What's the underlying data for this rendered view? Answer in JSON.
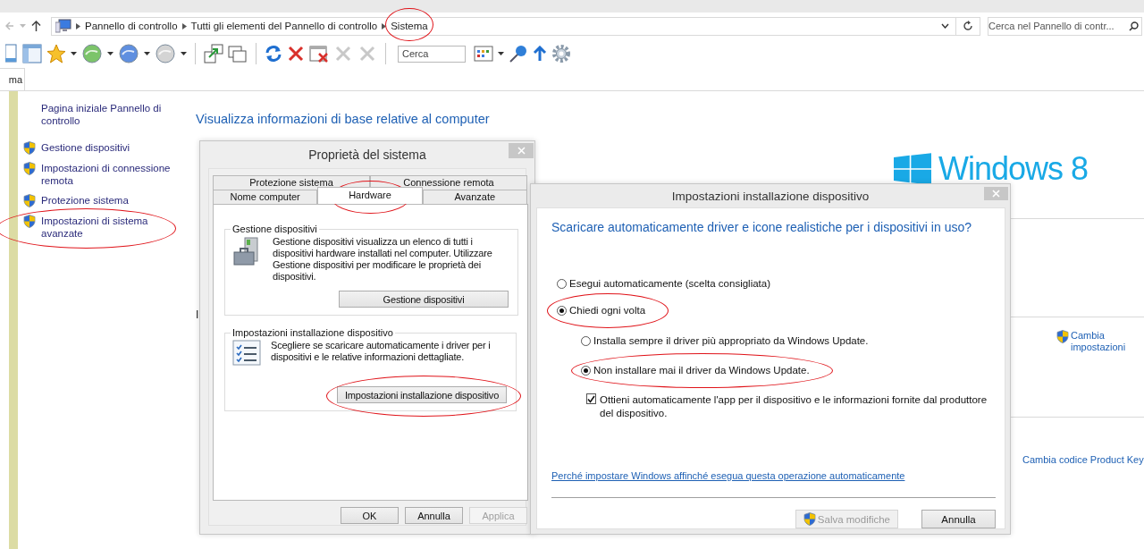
{
  "address_bar": {
    "breadcrumbs": [
      {
        "label": "Pannello di controllo",
        "circled": false
      },
      {
        "label": "Tutti gli elementi del Pannello di controllo",
        "circled": false
      },
      {
        "label": "Sistema",
        "circled": true
      }
    ],
    "search_placeholder": "Cerca nel Pannello di contr..."
  },
  "toolbar": {
    "search_placeholder": "Cerca",
    "tab_fragment": "ma"
  },
  "sidebar": {
    "home_link": "Pagina iniziale Pannello di controllo",
    "items": [
      {
        "label": "Gestione dispositivi",
        "circled": false
      },
      {
        "label": "Impostazioni di connessione remota",
        "circled": false
      },
      {
        "label": "Protezione sistema",
        "circled": false
      },
      {
        "label": "Impostazioni di sistema avanzate",
        "circled": true
      }
    ]
  },
  "main": {
    "heading": "Visualizza informazioni di base relative al computer",
    "fragments": [
      "I"
    ],
    "logo_text": "Windows 8",
    "links": [
      {
        "label": "Cambia impostazioni",
        "shield": true
      },
      {
        "label": "Cambia codice Product Key",
        "shield": false
      }
    ]
  },
  "system_properties": {
    "title": "Proprietà del sistema",
    "tab_rows": [
      {
        "tabs": [
          {
            "label": "Protezione sistema",
            "selected": false,
            "circled": false
          },
          {
            "label": "Connessione remota",
            "selected": false,
            "circled": false
          }
        ]
      },
      {
        "tabs": [
          {
            "label": "Nome computer",
            "selected": false,
            "circled": false
          },
          {
            "label": "Hardware",
            "selected": true,
            "circled": true
          },
          {
            "label": "Avanzate",
            "selected": false,
            "circled": false
          }
        ]
      }
    ],
    "groups": [
      {
        "kind": "device-manager",
        "title": "Gestione dispositivi",
        "text": "Gestione dispositivi visualizza un elenco di tutti i dispositivi hardware installati nel computer. Utilizzare Gestione dispositivi per modificare le proprietà dei dispositivi.",
        "button": {
          "label": "Gestione dispositivi",
          "circled": false
        }
      },
      {
        "kind": "install-settings",
        "title": "Impostazioni installazione dispositivo",
        "text": "Scegliere se scaricare automaticamente i driver per i dispositivi e le relative informazioni dettagliate.",
        "button": {
          "label": "Impostazioni installazione dispositivo",
          "circled": true
        }
      }
    ],
    "buttons": [
      {
        "label": "OK",
        "disabled": false
      },
      {
        "label": "Annulla",
        "disabled": false
      },
      {
        "label": "Applica",
        "disabled": true
      }
    ]
  },
  "install_settings": {
    "title": "Impostazioni installazione dispositivo",
    "question": "Scaricare automaticamente driver e icone realistiche per i dispositivi in uso?",
    "options": [
      {
        "label": "Esegui automaticamente (scelta consigliata)",
        "selected": false,
        "circled": false
      },
      {
        "label": "Chiedi ogni volta",
        "selected": true,
        "circled": true,
        "children": [
          {
            "label": "Installa sempre il driver più appropriato da Windows Update.",
            "selected": false,
            "circled": false
          },
          {
            "label": "Non installare mai il driver da Windows Update.",
            "selected": true,
            "circled": true
          }
        ]
      }
    ],
    "checkbox": {
      "label": "Ottieni automaticamente l'app per il dispositivo e le informazioni fornite dal produttore del dispositivo.",
      "checked": true
    },
    "link": "Perché impostare Windows affinché esegua questa operazione automaticamente",
    "buttons": [
      {
        "label": "Salva modifiche",
        "disabled": true,
        "shield": true
      },
      {
        "label": "Annulla",
        "disabled": false,
        "shield": false
      }
    ]
  }
}
